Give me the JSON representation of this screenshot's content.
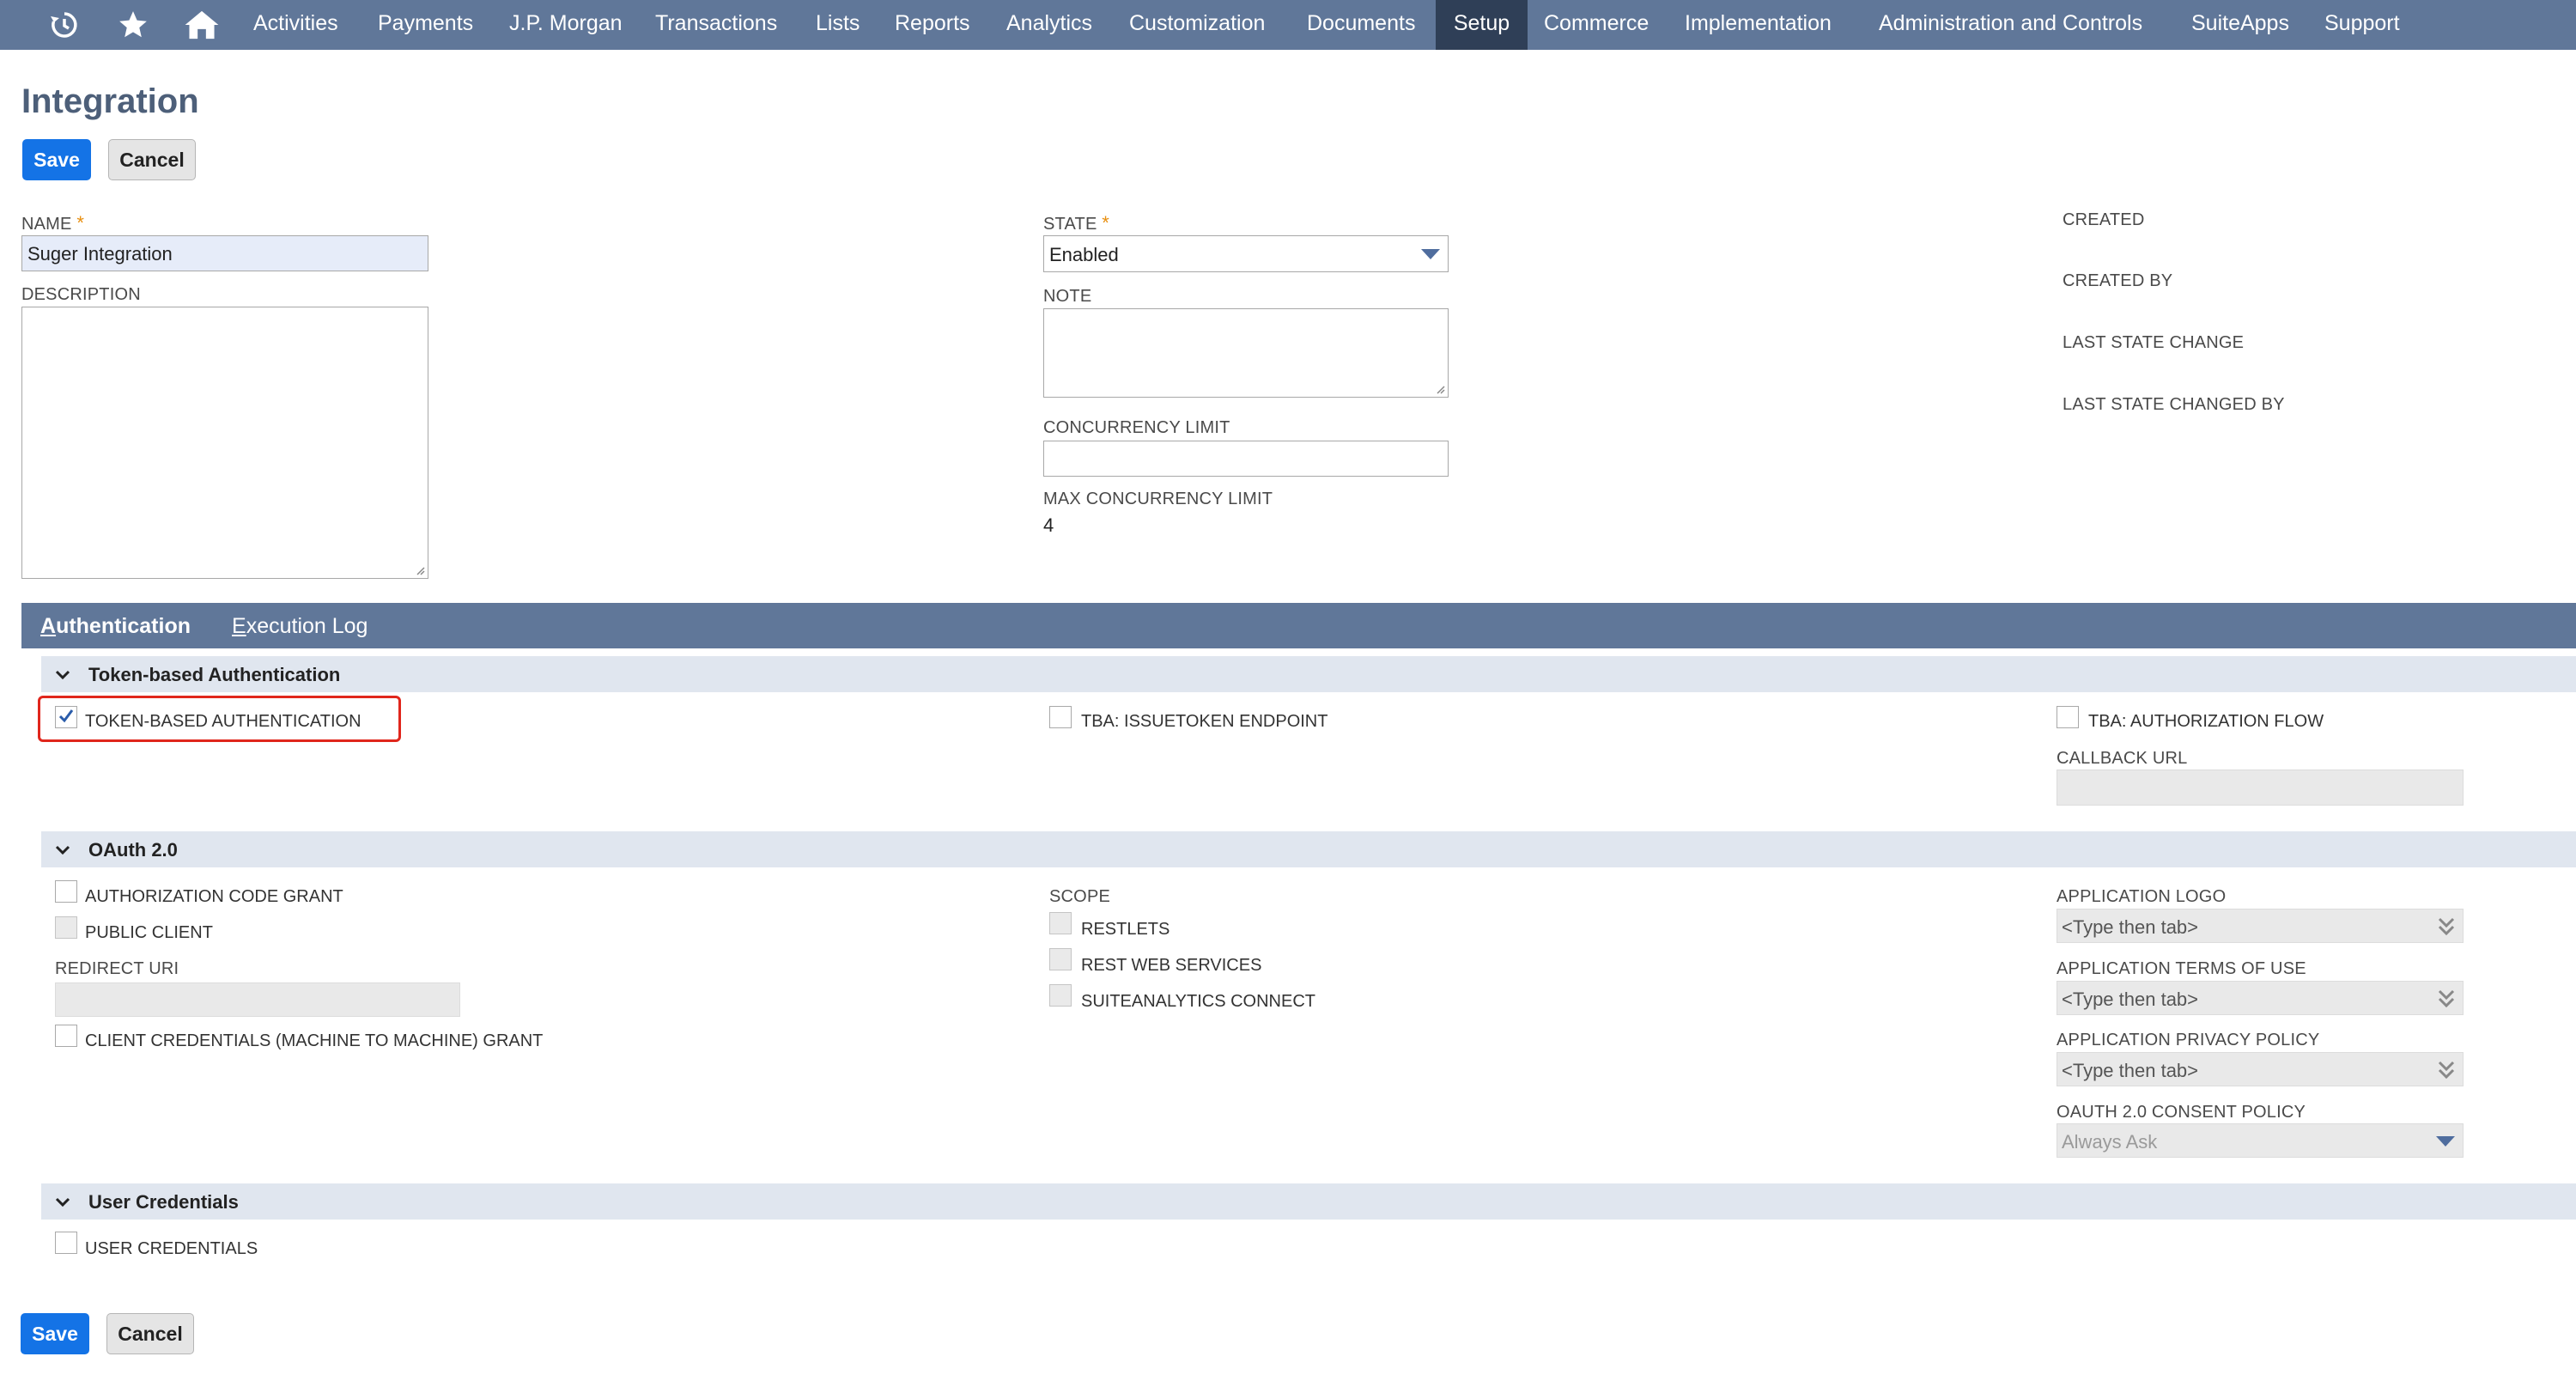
{
  "nav": {
    "items": [
      "Activities",
      "Payments",
      "J.P. Morgan",
      "Transactions",
      "Lists",
      "Reports",
      "Analytics",
      "Customization",
      "Documents",
      "Setup",
      "Commerce",
      "Implementation",
      "Administration and Controls",
      "SuiteApps",
      "Support"
    ],
    "active": "Setup",
    "icons": [
      "recent-history-icon",
      "star-icon",
      "home-icon"
    ]
  },
  "page": {
    "title": "Integration",
    "save_label": "Save",
    "cancel_label": "Cancel"
  },
  "form": {
    "name_label": "NAME",
    "name_value": "Suger Integration",
    "description_label": "DESCRIPTION",
    "description_value": "",
    "state_label": "STATE",
    "state_value": "Enabled",
    "note_label": "NOTE",
    "note_value": "",
    "concurrency_label": "CONCURRENCY LIMIT",
    "concurrency_value": "",
    "max_concurrency_label": "MAX CONCURRENCY LIMIT",
    "max_concurrency_value": "4",
    "required_mark": "*",
    "created_label": "CREATED",
    "created_by_label": "CREATED BY",
    "last_state_change_label": "LAST STATE CHANGE",
    "last_state_changed_by_label": "LAST STATE CHANGED BY"
  },
  "tabs": {
    "authentication": {
      "first": "A",
      "rest": "uthentication"
    },
    "execution_log": {
      "first": "E",
      "rest": "xecution Log"
    }
  },
  "tba": {
    "title": "Token-based Authentication",
    "token_based_auth": {
      "label": "TOKEN-BASED AUTHENTICATION",
      "checked": true
    },
    "issuetoken_endpoint": {
      "label": "TBA: ISSUETOKEN ENDPOINT",
      "checked": false
    },
    "authorization_flow": {
      "label": "TBA: AUTHORIZATION FLOW",
      "checked": false
    },
    "callback_url_label": "CALLBACK URL",
    "callback_url_value": ""
  },
  "oauth": {
    "title": "OAuth 2.0",
    "authorization_code_grant": "AUTHORIZATION CODE GRANT",
    "public_client": "PUBLIC CLIENT",
    "redirect_uri_label": "REDIRECT URI",
    "client_credentials": "CLIENT CREDENTIALS (MACHINE TO MACHINE) GRANT",
    "scope_label": "SCOPE",
    "restlets": "RESTLETS",
    "rest_web_services": "REST WEB SERVICES",
    "suiteanalytics_connect": "SUITEANALYTICS CONNECT",
    "app_logo_label": "APPLICATION LOGO",
    "app_logo_placeholder": "<Type then tab>",
    "app_terms_label": "APPLICATION TERMS OF USE",
    "app_terms_placeholder": "<Type then tab>",
    "app_privacy_label": "APPLICATION PRIVACY POLICY",
    "app_privacy_placeholder": "<Type then tab>",
    "consent_policy_label": "OAUTH 2.0 CONSENT POLICY",
    "consent_policy_value": "Always Ask"
  },
  "user_credentials": {
    "title": "User Credentials",
    "checkbox_label": "USER CREDENTIALS"
  },
  "colors": {
    "nav_bg": "#607799",
    "nav_active": "#2f3f57",
    "primary_button": "#1473e6",
    "section_bg": "#e0e6ef",
    "highlight": "#e0261c"
  }
}
